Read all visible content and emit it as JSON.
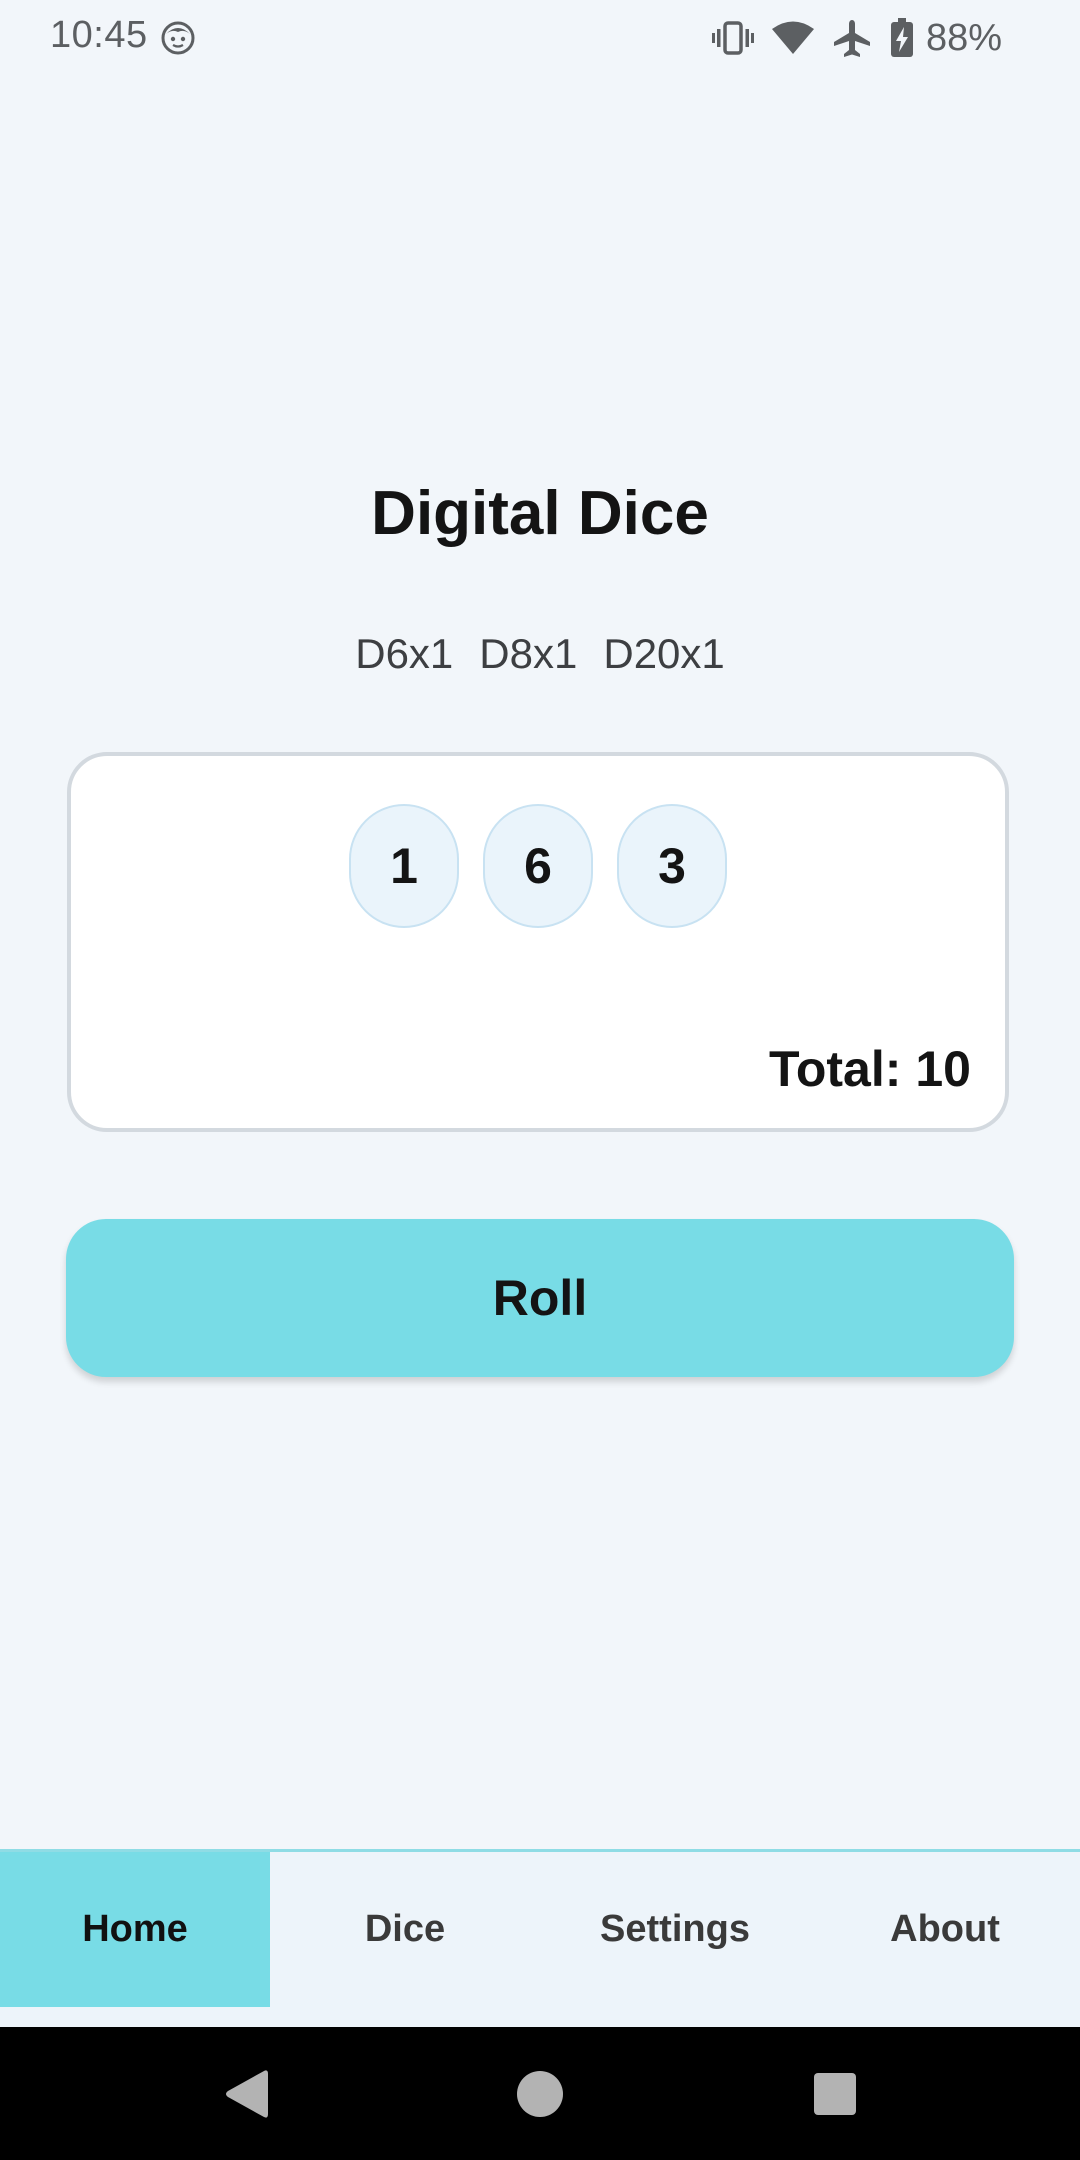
{
  "status_bar": {
    "time": "10:45",
    "battery": "88%",
    "icons": [
      "face-icon",
      "vibrate-icon",
      "wifi-icon",
      "airplane-icon",
      "battery-charging-icon"
    ]
  },
  "app": {
    "title": "Digital Dice",
    "dice_config": [
      "D6x1",
      "D8x1",
      "D20x1"
    ],
    "results": [
      "1",
      "6",
      "3"
    ],
    "total_label": "Total:",
    "total_value": "10",
    "roll_label": "Roll"
  },
  "tabs": [
    {
      "label": "Home",
      "active": true
    },
    {
      "label": "Dice",
      "active": false
    },
    {
      "label": "Settings",
      "active": false
    },
    {
      "label": "About",
      "active": false
    }
  ],
  "nav_bar": {
    "buttons": [
      "back-icon",
      "home-icon",
      "recents-icon"
    ]
  },
  "colors": {
    "background": "#f2f6fa",
    "accent": "#78dce6",
    "die_fill": "#eaf4fb",
    "card_border": "#d3d9df"
  }
}
